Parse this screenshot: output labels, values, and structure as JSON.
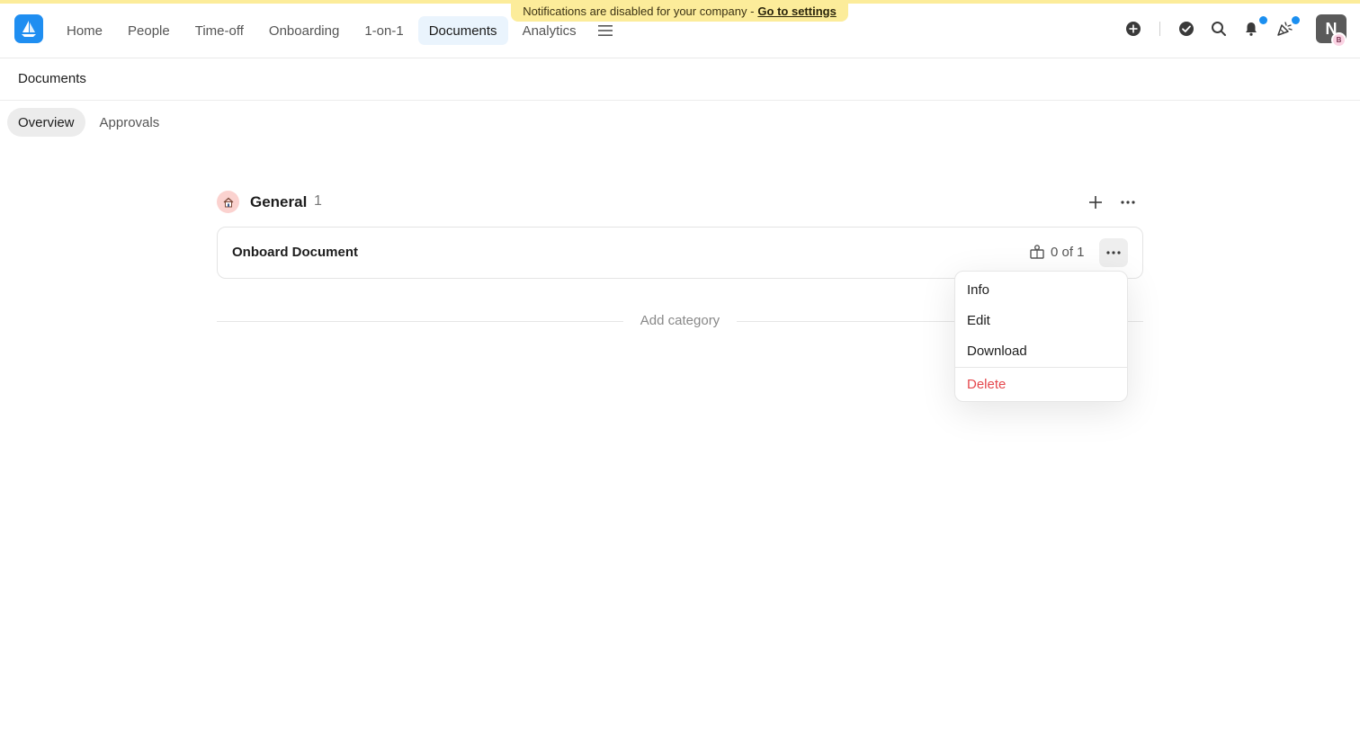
{
  "notice": {
    "text": "Notifications are disabled for your company -",
    "link": "Go to settings"
  },
  "nav": {
    "items": [
      {
        "label": "Home"
      },
      {
        "label": "People"
      },
      {
        "label": "Time-off"
      },
      {
        "label": "Onboarding"
      },
      {
        "label": "1-on-1"
      },
      {
        "label": "Documents",
        "active": true
      },
      {
        "label": "Analytics"
      }
    ],
    "menu_icon": "hamburger-icon"
  },
  "header_icons": [
    "plus-circle-icon",
    "check-circle-icon",
    "search-icon",
    "bell-icon",
    "celebration-icon"
  ],
  "avatar": {
    "initial": "N",
    "badge": "B"
  },
  "page": {
    "title": "Documents"
  },
  "tabs": [
    {
      "label": "Overview",
      "active": true
    },
    {
      "label": "Approvals"
    }
  ],
  "category": {
    "title": "General",
    "count": "1"
  },
  "document": {
    "title": "Onboard Document",
    "signed": "0 of 1"
  },
  "add_category": "Add category",
  "dropdown": {
    "info": "Info",
    "edit": "Edit",
    "download": "Download",
    "delete": "Delete"
  },
  "colors": {
    "accent": "#1f8ef1",
    "notice_bg": "#fcec9a",
    "danger": "#e5484d",
    "active_nav_bg": "#eaf4fd"
  }
}
